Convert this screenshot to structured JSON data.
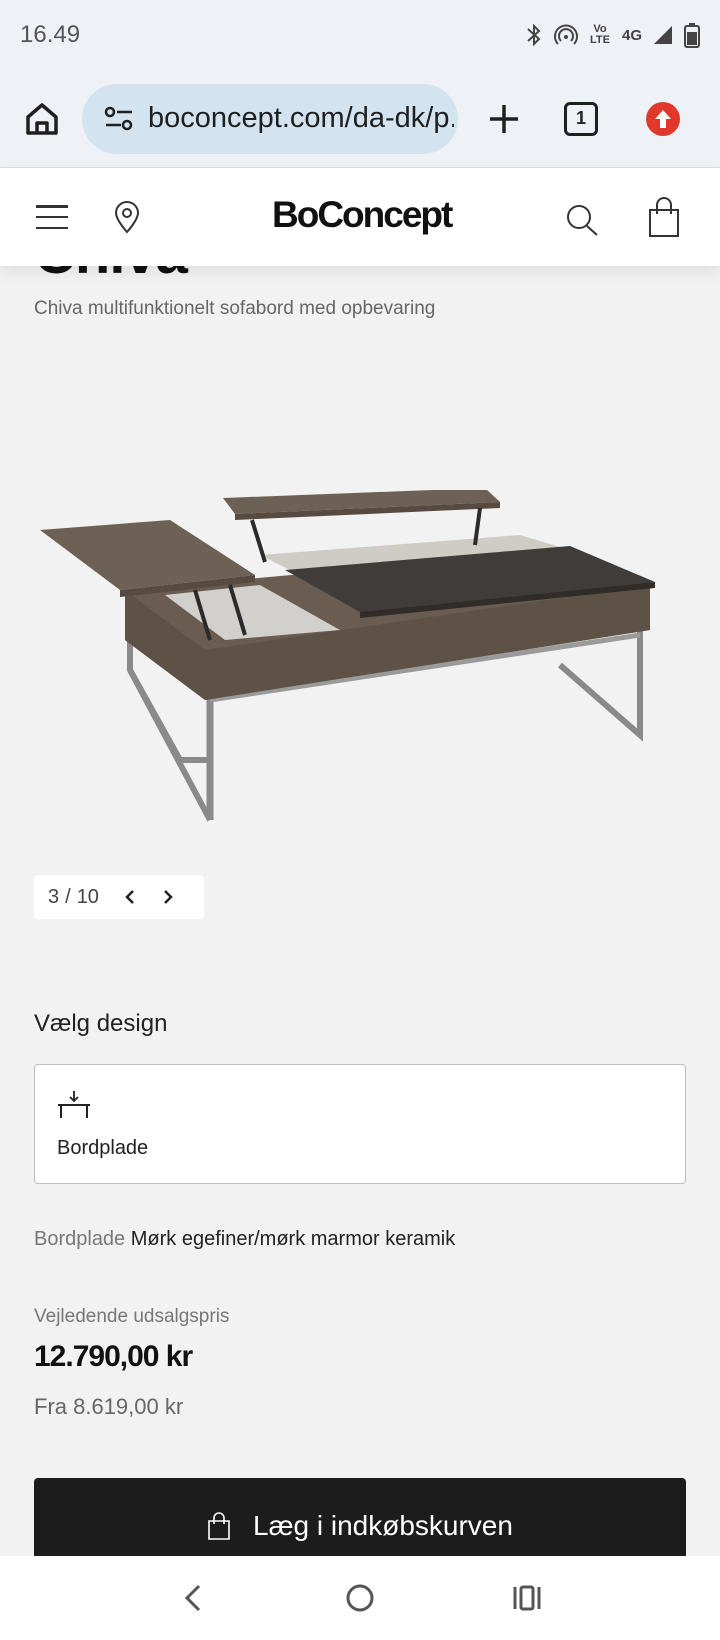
{
  "status": {
    "time": "16.49",
    "volte_label": "Vo LTE",
    "network_label": "4G",
    "icons": [
      "bluetooth-icon",
      "hotspot-icon",
      "volte-icon",
      "4g-icon",
      "signal-icon",
      "battery-icon"
    ]
  },
  "browser": {
    "url": "boconcept.com/da-dk/p...",
    "tab_count": "1"
  },
  "header": {
    "brand": "BoConcept"
  },
  "product": {
    "title_peek": "Chiva",
    "subtitle": "Chiva multifunktionelt sofabord med opbevaring",
    "image_alt": "Chiva coffee table with lift-up tops",
    "pager": {
      "current": "3",
      "separator": "/",
      "total": "10"
    }
  },
  "design": {
    "heading": "Vælg design",
    "option_label": "Bordplade"
  },
  "spec": {
    "key": "Bordplade",
    "value": "Mørk egefiner/mørk marmor keramik"
  },
  "pricing": {
    "label": "Vejledende udsalgspris",
    "price": "12.790,00 kr",
    "from": "Fra 8.619,00 kr"
  },
  "cta": {
    "add_to_cart": "Læg i indkøbskurven"
  },
  "colors": {
    "accent_red": "#e2382b",
    "cta_bg": "#1c1c1c",
    "page_bg": "#f2f2f2"
  }
}
